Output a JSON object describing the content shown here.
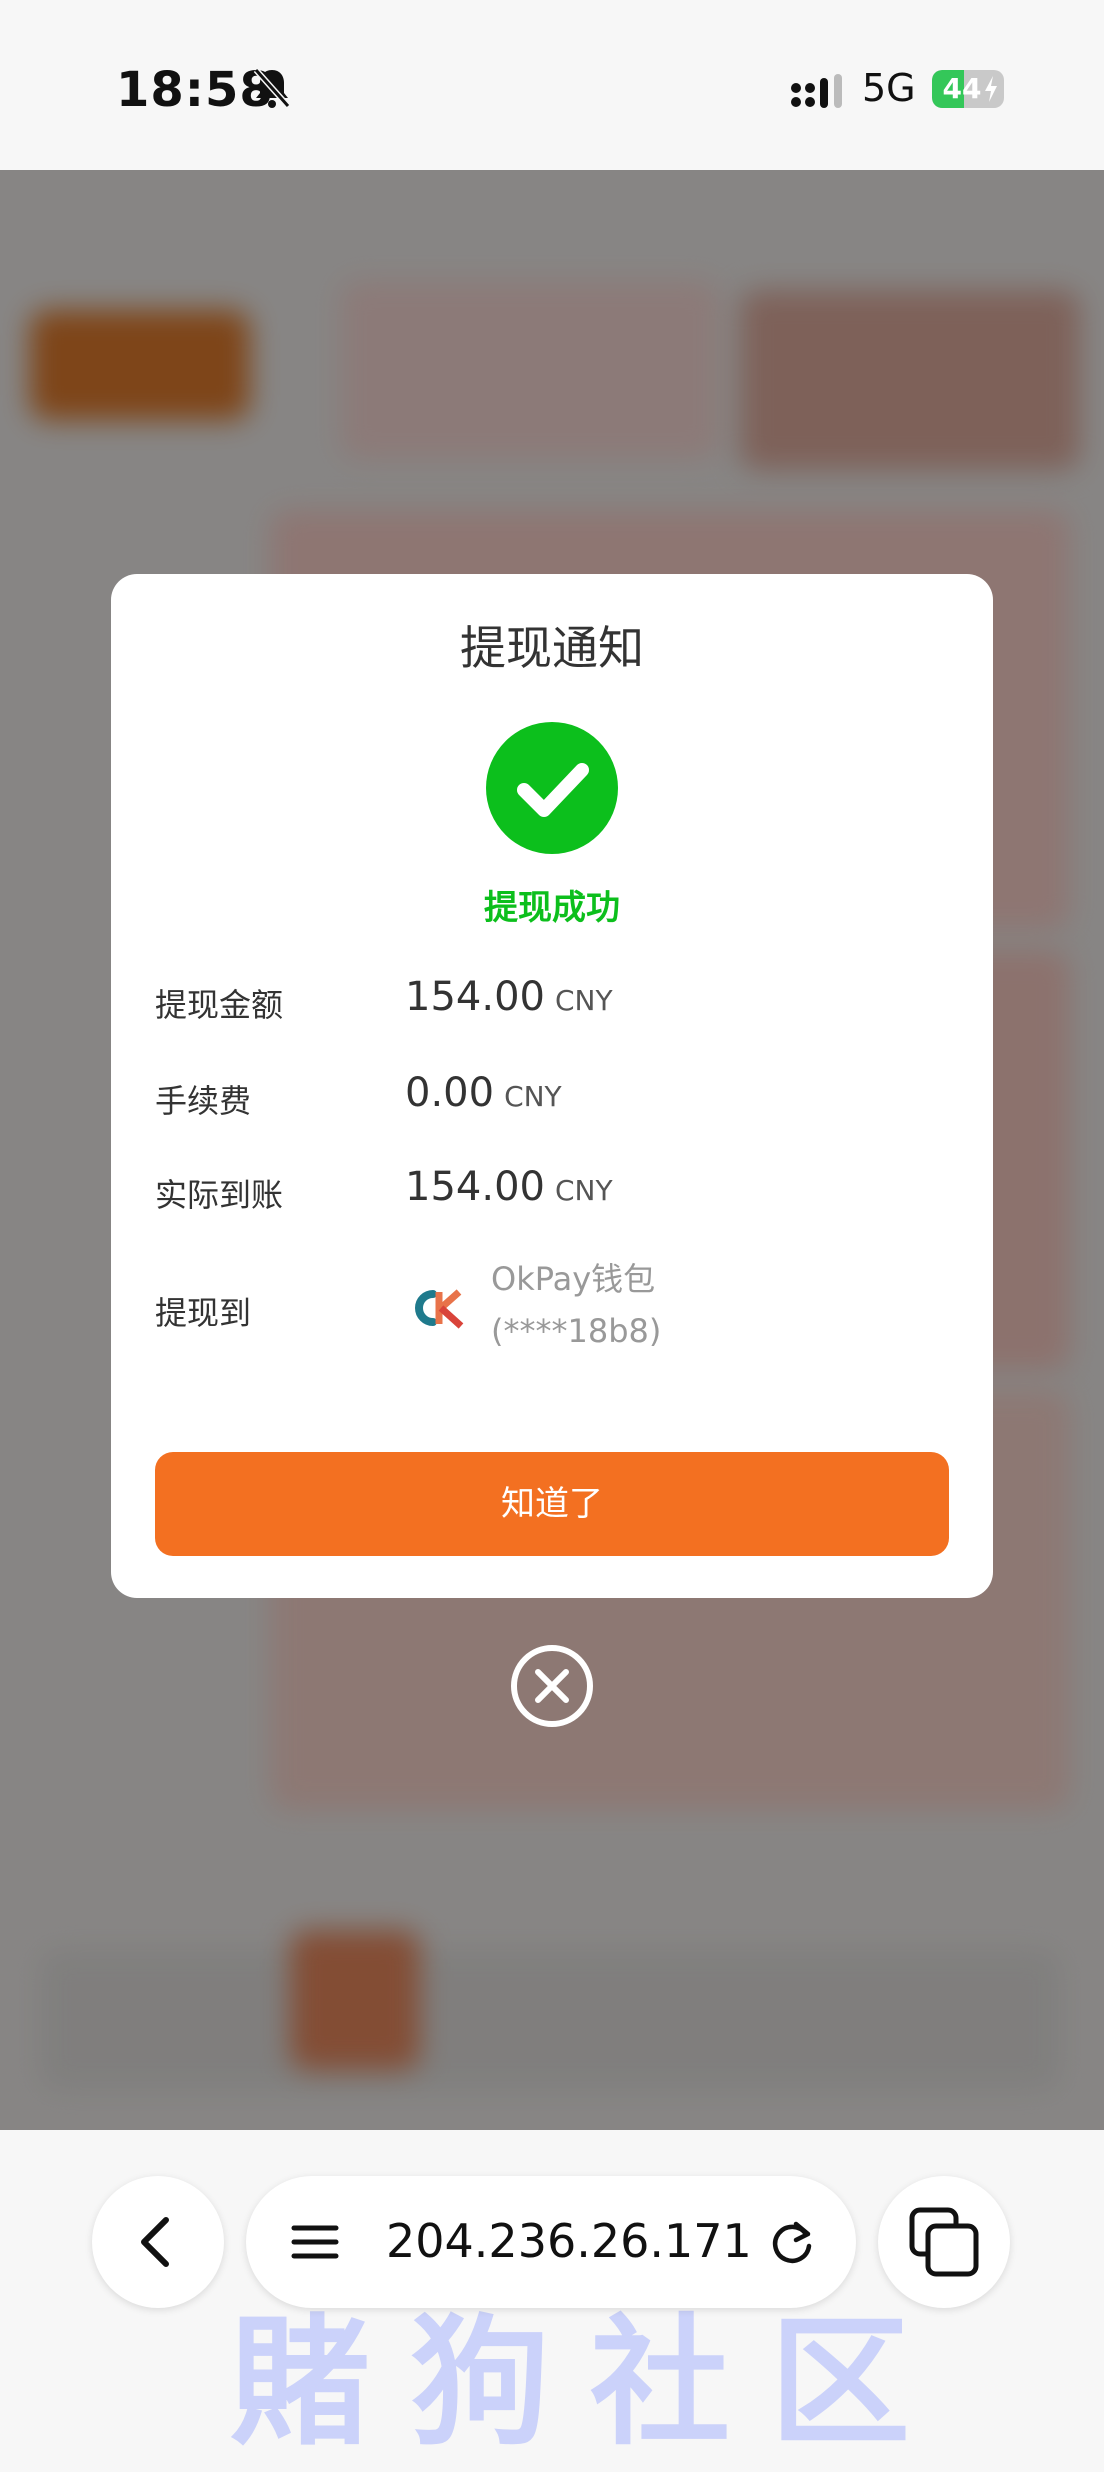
{
  "status_bar": {
    "time": "18:58",
    "network": "5G",
    "battery": "44",
    "battery_level": 0.44
  },
  "dialog": {
    "title": "提现通知",
    "status": "提现成功",
    "rows": [
      {
        "label": "提现金额",
        "value": "154.00",
        "currency": "CNY"
      },
      {
        "label": "手续费",
        "value": "0.00",
        "currency": "CNY"
      },
      {
        "label": "实际到账",
        "value": "154.00",
        "currency": "CNY"
      }
    ],
    "destination_label": "提现到",
    "wallet_name": "OkPay钱包",
    "wallet_account": "(****18b8)",
    "confirm_label": "知道了"
  },
  "browser": {
    "url": "204.236.26.171"
  },
  "watermark": "賭狗社区",
  "colors": {
    "success": "#0cbf1c",
    "accent": "#f37021"
  }
}
